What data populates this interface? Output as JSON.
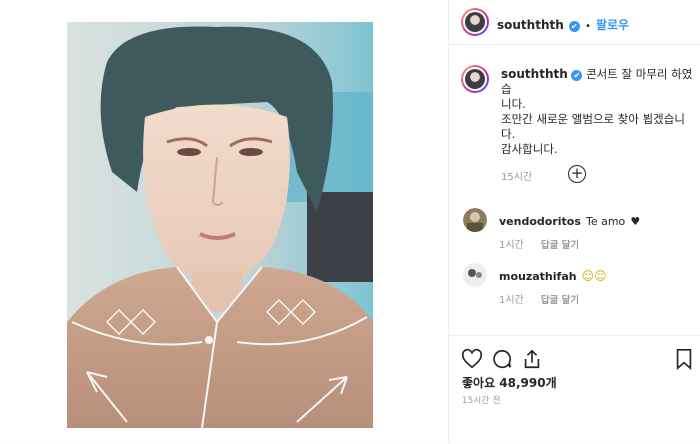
{
  "post": {
    "username": "souththth",
    "verified_mark": "✔",
    "separator": "•",
    "follow_label": "팔로우",
    "caption": {
      "line1": "콘서트 잘 마무리 하였습",
      "line2": "니다.",
      "line3": "조만간 새로운 앨범으로 찾아 뵙겠습니",
      "line4": "다.",
      "line5": "감사합니다."
    },
    "caption_time": "15시간",
    "load_more_icon": "plus-circle-icon",
    "comments": [
      {
        "username": "vendodoritos",
        "text": "Te amo",
        "emoji": "♥",
        "time": "1시간",
        "reply": "답글 달기"
      },
      {
        "username": "mouzathifah",
        "text": "",
        "emoji": "☺☺",
        "time": "1시간",
        "reply": "답글 달기"
      }
    ],
    "likes_label": "좋아요 48,990개",
    "posted_ago": "15시간 전",
    "icons": [
      "heart-icon",
      "comment-icon",
      "share-icon",
      "bookmark-icon"
    ],
    "colors": {
      "link": "#3897f0",
      "muted": "#999999",
      "text": "#262626",
      "border": "#efefef"
    }
  }
}
